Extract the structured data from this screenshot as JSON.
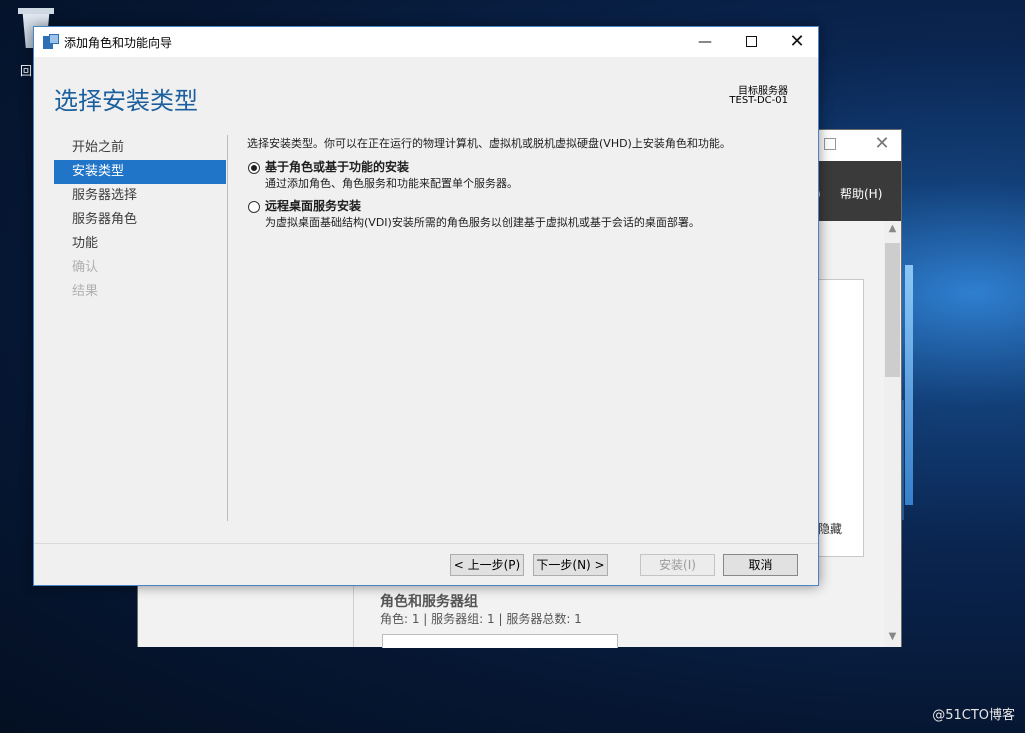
{
  "desktop": {
    "recycle_bin_label": "回",
    "watermark": "@51CTO博客"
  },
  "server_manager": {
    "menu_partial": ")",
    "menu_help": "帮助(H)",
    "hide_label": "隐藏",
    "section_title": "角色和服务器组",
    "section_sub": "角色: 1 | 服务器组: 1 | 服务器总数: 1"
  },
  "wizard": {
    "title": "添加角色和功能向导",
    "page_title": "选择安装类型",
    "destination_label": "目标服务器",
    "destination_value": "TEST-DC-01",
    "nav": [
      {
        "label": "开始之前",
        "state": "normal"
      },
      {
        "label": "安装类型",
        "state": "active"
      },
      {
        "label": "服务器选择",
        "state": "normal"
      },
      {
        "label": "服务器角色",
        "state": "normal"
      },
      {
        "label": "功能",
        "state": "normal"
      },
      {
        "label": "确认",
        "state": "disabled"
      },
      {
        "label": "结果",
        "state": "disabled"
      }
    ],
    "intro": "选择安装类型。你可以在正在运行的物理计算机、虚拟机或脱机虚拟硬盘(VHD)上安装角色和功能。",
    "options": [
      {
        "title": "基于角色或基于功能的安装",
        "description": "通过添加角色、角色服务和功能来配置单个服务器。",
        "selected": true
      },
      {
        "title": "远程桌面服务安装",
        "description": "为虚拟桌面基础结构(VDI)安装所需的角色服务以创建基于虚拟机或基于会话的桌面部署。",
        "selected": false
      }
    ],
    "buttons": {
      "prev": "< 上一步(P)",
      "next": "下一步(N) >",
      "install": "安装(I)",
      "cancel": "取消"
    }
  },
  "colors": {
    "accent": "#2175c8",
    "title_blue": "#1c5f9e"
  }
}
